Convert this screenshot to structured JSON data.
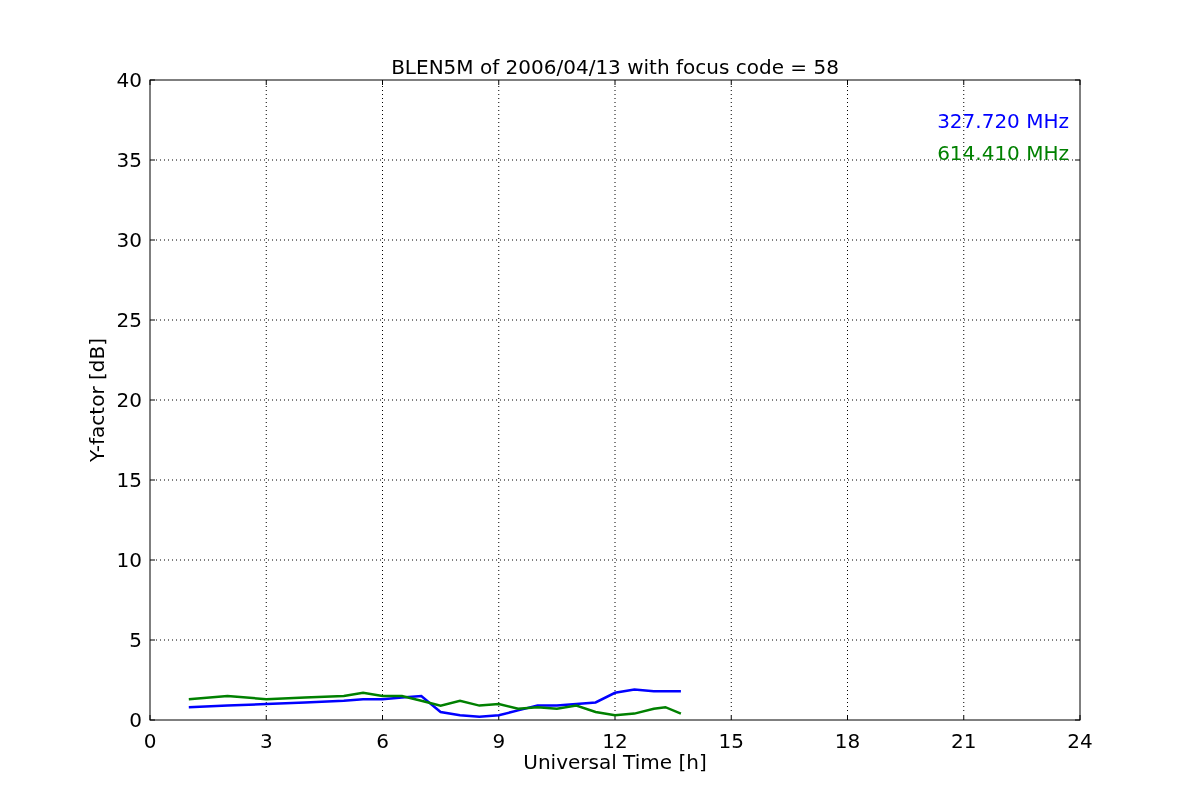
{
  "chart": {
    "chart_data": {
      "type": "line",
      "title": "BLEN5M of 2006/04/13 with focus code = 58",
      "xlabel": "Universal Time [h]",
      "ylabel": "Y-factor [dB]",
      "x": [
        1,
        2,
        3,
        4,
        5,
        5.5,
        6,
        6.5,
        7,
        7.5,
        8,
        8.5,
        9,
        9.5,
        10,
        10.5,
        11,
        11.5,
        12,
        12.5,
        13,
        13.3,
        13.7
      ],
      "series": [
        {
          "name": "327.720 MHz",
          "color": "#0000ff",
          "values": [
            0.8,
            0.9,
            1.0,
            1.1,
            1.2,
            1.3,
            1.3,
            1.4,
            1.5,
            0.5,
            0.3,
            0.2,
            0.3,
            0.6,
            0.9,
            0.9,
            1.0,
            1.1,
            1.7,
            1.9,
            1.8,
            1.8,
            1.8
          ]
        },
        {
          "name": "614.410 MHz",
          "color": "#008000",
          "values": [
            1.3,
            1.5,
            1.3,
            1.4,
            1.5,
            1.7,
            1.5,
            1.5,
            1.2,
            0.9,
            1.2,
            0.9,
            1.0,
            0.7,
            0.8,
            0.7,
            0.9,
            0.5,
            0.3,
            0.4,
            0.7,
            0.8,
            0.4
          ]
        }
      ],
      "xlim": [
        0,
        24
      ],
      "ylim": [
        0,
        40
      ],
      "xticks": [
        0,
        3,
        6,
        9,
        12,
        15,
        18,
        21,
        24
      ],
      "yticks": [
        0,
        5,
        10,
        15,
        20,
        25,
        30,
        35,
        40
      ],
      "grid": true
    }
  }
}
